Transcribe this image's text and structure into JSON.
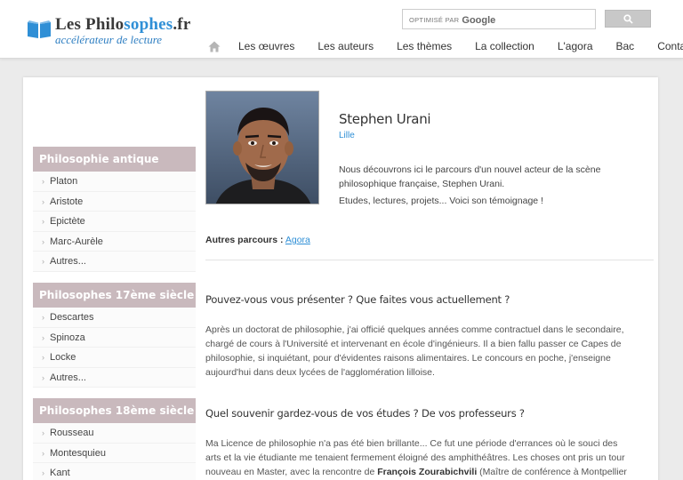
{
  "header": {
    "logo": {
      "title_prefix": "Les Philo",
      "title_highlight": "sophes",
      "title_suffix": ".fr",
      "tagline": "accélérateur de lecture"
    },
    "search": {
      "powered_by": "OPTIMISÉ PAR",
      "brand": "Google"
    },
    "nav": [
      "Les œuvres",
      "Les auteurs",
      "Les thèmes",
      "La collection",
      "L'agora",
      "Bac",
      "Contact"
    ]
  },
  "sidebar": [
    {
      "title": "Philosophie antique",
      "items": [
        "Platon",
        "Aristote",
        "Epictète",
        "Marc-Aurèle",
        "Autres..."
      ]
    },
    {
      "title": "Philosophes 17ème siècle",
      "items": [
        "Descartes",
        "Spinoza",
        "Locke",
        "Autres..."
      ]
    },
    {
      "title": "Philosophes 18ème siècle",
      "items": [
        "Rousseau",
        "Montesquieu",
        "Kant"
      ]
    }
  ],
  "profile": {
    "name": "Stephen Urani",
    "city": "Lille",
    "intro1": "Nous découvrons ici le parcours d'un nouvel acteur de la scène philosophique française, Stephen Urani.",
    "intro2": "Etudes, lectures, projets... Voici son témoignage !",
    "parcours_label": "Autres parcours :",
    "parcours_link": "Agora"
  },
  "article": {
    "q1": "Pouvez-vous vous présenter ? Que faites vous actuellement ?",
    "p1": "Après un doctorat de philosophie, j'ai officié quelques années comme contractuel dans le secondaire, chargé de cours à l'Université et intervenant en école d'ingénieurs. Il a bien fallu passer ce Capes de philosophie, si inquiétant, pour d'évidentes raisons alimentaires. Le concours en poche, j'enseigne aujourd'hui dans deux lycées de l'agglomération lilloise.",
    "q2": "Quel souvenir gardez-vous de vos études ? De vos professeurs ?",
    "p2_start": "Ma Licence de philosophie n'a pas été bien brillante... Ce fut une période d'errances où le souci des arts et la vie étudiante me tenaient fermement éloigné des amphithéâtres. Les choses ont pris un tour nouveau en Master, avec la rencontre de ",
    "p2_bold": "François Zourabichvili",
    "p2_end": " (Maître de conférence à Montpellier"
  },
  "colors": {
    "accent": "#2f8fd6",
    "sidebar_header": "#c9b9bd",
    "background": "#ebebeb"
  }
}
